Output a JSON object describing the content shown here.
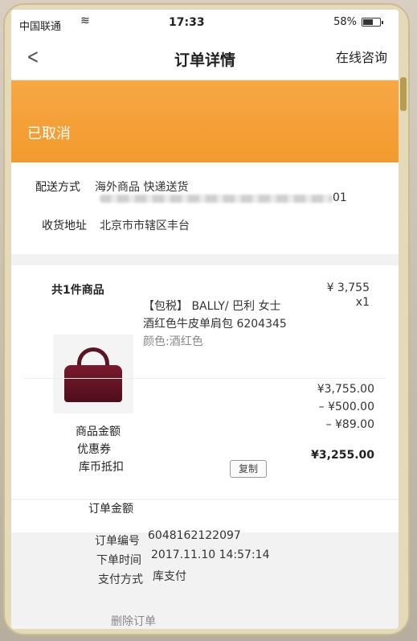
{
  "status_bar": {
    "carrier": "中国联通",
    "time": "17:33",
    "battery": "58%",
    "battery_level": 0.58
  },
  "nav": {
    "title": "订单详情",
    "right_action": "在线咨询"
  },
  "order_status": "已取消",
  "delivery": {
    "label": "配送方式",
    "value": "海外商品 快递送货"
  },
  "address": {
    "label": "收货地址",
    "line1_suffix": "01",
    "line2": "北京市市辖区丰台"
  },
  "goods": {
    "heading": "共1件商品",
    "item": {
      "title_line1": "【包税】 BALLY/ 巴利 女士",
      "title_line2": "酒红色牛皮单肩包 6204345",
      "color": "颜色:酒红色",
      "price": "¥ 3,755",
      "qty": "x1"
    }
  },
  "amounts": {
    "goods_total_label": "商品金额",
    "goods_total": "¥3,755.00",
    "coupon_label": "优惠券",
    "coupon": "– ¥500.00",
    "coin_label": "库币抵扣",
    "coin": "– ¥89.00",
    "final": "¥3,255.00"
  },
  "order_amount_label": "订单金额",
  "order_info": {
    "number_label": "订单编号",
    "number": "6048162122097",
    "copy": "复制",
    "time_label": "下单时间",
    "time": "2017.11.10 14:57:14",
    "pay_label": "支付方式",
    "pay": "库支付"
  },
  "delete_order": "删除订单"
}
